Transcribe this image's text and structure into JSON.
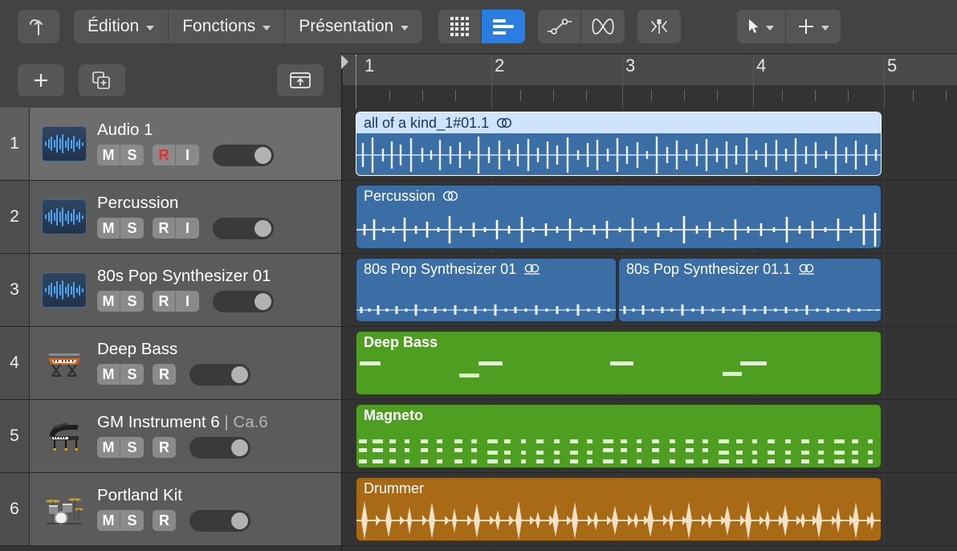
{
  "app": "Logic Pro - Arrange window (French UI)",
  "toolbar": {
    "nav_up_icon": "arrow-up-icon",
    "menus": [
      {
        "label": "Édition",
        "icon": "chevron-down-icon"
      },
      {
        "label": "Fonctions",
        "icon": "chevron-down-icon"
      },
      {
        "label": "Présentation",
        "icon": "chevron-down-icon"
      }
    ],
    "view_toggle": [
      {
        "name": "grid-view",
        "icon": "grid-icon",
        "active": false
      },
      {
        "name": "list-view",
        "icon": "list-icon",
        "active": true
      }
    ],
    "editor_buttons": [
      {
        "name": "automation",
        "icon": "automation-node-icon"
      },
      {
        "name": "flex",
        "icon": "flex-curve-icon"
      }
    ],
    "snap_button": {
      "name": "snap-to-marker",
      "icon": "snap-marker-icon"
    },
    "tools": [
      {
        "name": "pointer-tool",
        "icon": "pointer-arrow-icon",
        "caret": true
      },
      {
        "name": "marquee-tool",
        "icon": "plus-crosshair-icon",
        "caret": true
      }
    ]
  },
  "left_header_bar": {
    "add_track": {
      "icon": "plus-icon",
      "label": "+"
    },
    "duplicate_track": {
      "icon": "duplicate-track-icon"
    },
    "open_library": {
      "icon": "open-panel-icon"
    }
  },
  "ruler": {
    "bars": [
      "1",
      "2",
      "3",
      "4",
      "5"
    ],
    "unit": "bars",
    "subdivisions_per_bar": 4
  },
  "tracks": [
    {
      "number": "1",
      "name": "Audio 1",
      "name_suffix": "",
      "icon": "audio-waveform-icon",
      "buttons": [
        "M",
        "S",
        "R",
        "I"
      ],
      "record_armed": true,
      "selected": true,
      "toggle_on": true
    },
    {
      "number": "2",
      "name": "Percussion",
      "name_suffix": "",
      "icon": "audio-waveform-icon",
      "buttons": [
        "M",
        "S",
        "R",
        "I"
      ],
      "record_armed": false,
      "selected": false,
      "toggle_on": true
    },
    {
      "number": "3",
      "name": "80s Pop Synthesizer 01",
      "name_suffix": "",
      "icon": "audio-waveform-icon",
      "buttons": [
        "M",
        "S",
        "R",
        "I"
      ],
      "record_armed": false,
      "selected": false,
      "toggle_on": true
    },
    {
      "number": "4",
      "name": "Deep Bass",
      "name_suffix": "",
      "icon": "synth-keyboard-icon",
      "buttons": [
        "M",
        "S",
        "R"
      ],
      "record_armed": false,
      "selected": false,
      "toggle_on": true
    },
    {
      "number": "5",
      "name": "GM Instrument 6",
      "name_suffix": " | Ca.6",
      "icon": "grand-piano-icon",
      "buttons": [
        "M",
        "S",
        "R"
      ],
      "record_armed": false,
      "selected": false,
      "toggle_on": true
    },
    {
      "number": "6",
      "name": "Portland Kit",
      "name_suffix": "",
      "icon": "drum-kit-icon",
      "buttons": [
        "M",
        "S",
        "R"
      ],
      "record_armed": false,
      "selected": false,
      "toggle_on": true
    }
  ],
  "regions": [
    {
      "track": "1",
      "title": "all of a kind_1#01.1",
      "badge": "stereo-circles-icon",
      "color": "#3a6ea5",
      "selected": true,
      "type": "audio"
    },
    {
      "track": "2",
      "title": "Percussion",
      "badge": "stereo-circles-icon",
      "color": "#3a6ea5",
      "selected": false,
      "type": "audio"
    },
    {
      "track": "3",
      "title": "80s Pop Synthesizer 01",
      "badge": "stereo-circles-underlined-icon",
      "color": "#3a6ea5",
      "selected": false,
      "type": "audio"
    },
    {
      "track": "3",
      "title": "80s Pop Synthesizer 01.1",
      "badge": "stereo-circles-underlined-icon",
      "color": "#3a6ea5",
      "selected": false,
      "type": "audio"
    },
    {
      "track": "4",
      "title": "Deep Bass",
      "badge": "",
      "color": "#4e9e22",
      "selected": false,
      "type": "midi"
    },
    {
      "track": "5",
      "title": "Magneto",
      "badge": "",
      "color": "#4e9e22",
      "selected": false,
      "type": "midi"
    },
    {
      "track": "6",
      "title": "Drummer",
      "badge": "",
      "color": "#a86a14",
      "selected": false,
      "type": "drummer"
    }
  ],
  "colors": {
    "accent_blue": "#2a7de1",
    "audio_region": "#3a6ea5",
    "midi_region": "#4e9e22",
    "drummer_region": "#a86a14",
    "record_red": "#e03030",
    "toolbar_bg": "#434343",
    "canvas_bg": "#333333"
  }
}
